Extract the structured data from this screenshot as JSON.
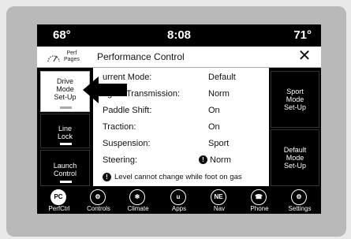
{
  "status": {
    "temp_left": "68°",
    "time": "8:08",
    "temp_right": "71°"
  },
  "header": {
    "perf_pages_line1": "Perf",
    "perf_pages_line2": "Pages",
    "title": "Performance Control",
    "close_glyph": "✕"
  },
  "left_menu": [
    {
      "line1": "Drive",
      "line2": "Mode",
      "line3": "Set-Up"
    },
    {
      "line1": "Line",
      "line2": "Lock"
    },
    {
      "line1": "Launch",
      "line2": "Control"
    }
  ],
  "right_menu": [
    {
      "line1": "Sport",
      "line2": "Mode",
      "line3": "Set-Up"
    },
    {
      "line1": "Default",
      "line2": "Mode",
      "line3": "Set-Up"
    }
  ],
  "settings": [
    {
      "label": "urrent Mode:",
      "value": "Default"
    },
    {
      "label": "ngine/Transmission:",
      "value": "Norm"
    },
    {
      "label": "Paddle Shift:",
      "value": "On"
    },
    {
      "label": "Traction:",
      "value": "On"
    },
    {
      "label": "Suspension:",
      "value": "Sport"
    },
    {
      "label": "Steering:",
      "value": "Norm"
    }
  ],
  "warning_glyph": "!",
  "note": "Level cannot change while foot on gas",
  "nav": [
    {
      "label": "PerfCtrl",
      "icon_text": "PC",
      "icon": "pc-icon"
    },
    {
      "label": "Controls",
      "icon_text": "⚙",
      "icon": "controls-icon"
    },
    {
      "label": "Climate",
      "icon_text": "❄",
      "icon": "climate-icon"
    },
    {
      "label": "Apps",
      "icon_text": "u",
      "icon": "apps-icon"
    },
    {
      "label": "Nav",
      "icon_text": "NE",
      "icon": "compass-icon"
    },
    {
      "label": "Phone",
      "icon_text": "☎",
      "icon": "phone-icon"
    },
    {
      "label": "Settings",
      "icon_text": "⚙",
      "icon": "settings-icon"
    }
  ],
  "colors": {
    "screen": "#000000",
    "panel": "#ffffff",
    "bezel": "#b9b9b9"
  }
}
